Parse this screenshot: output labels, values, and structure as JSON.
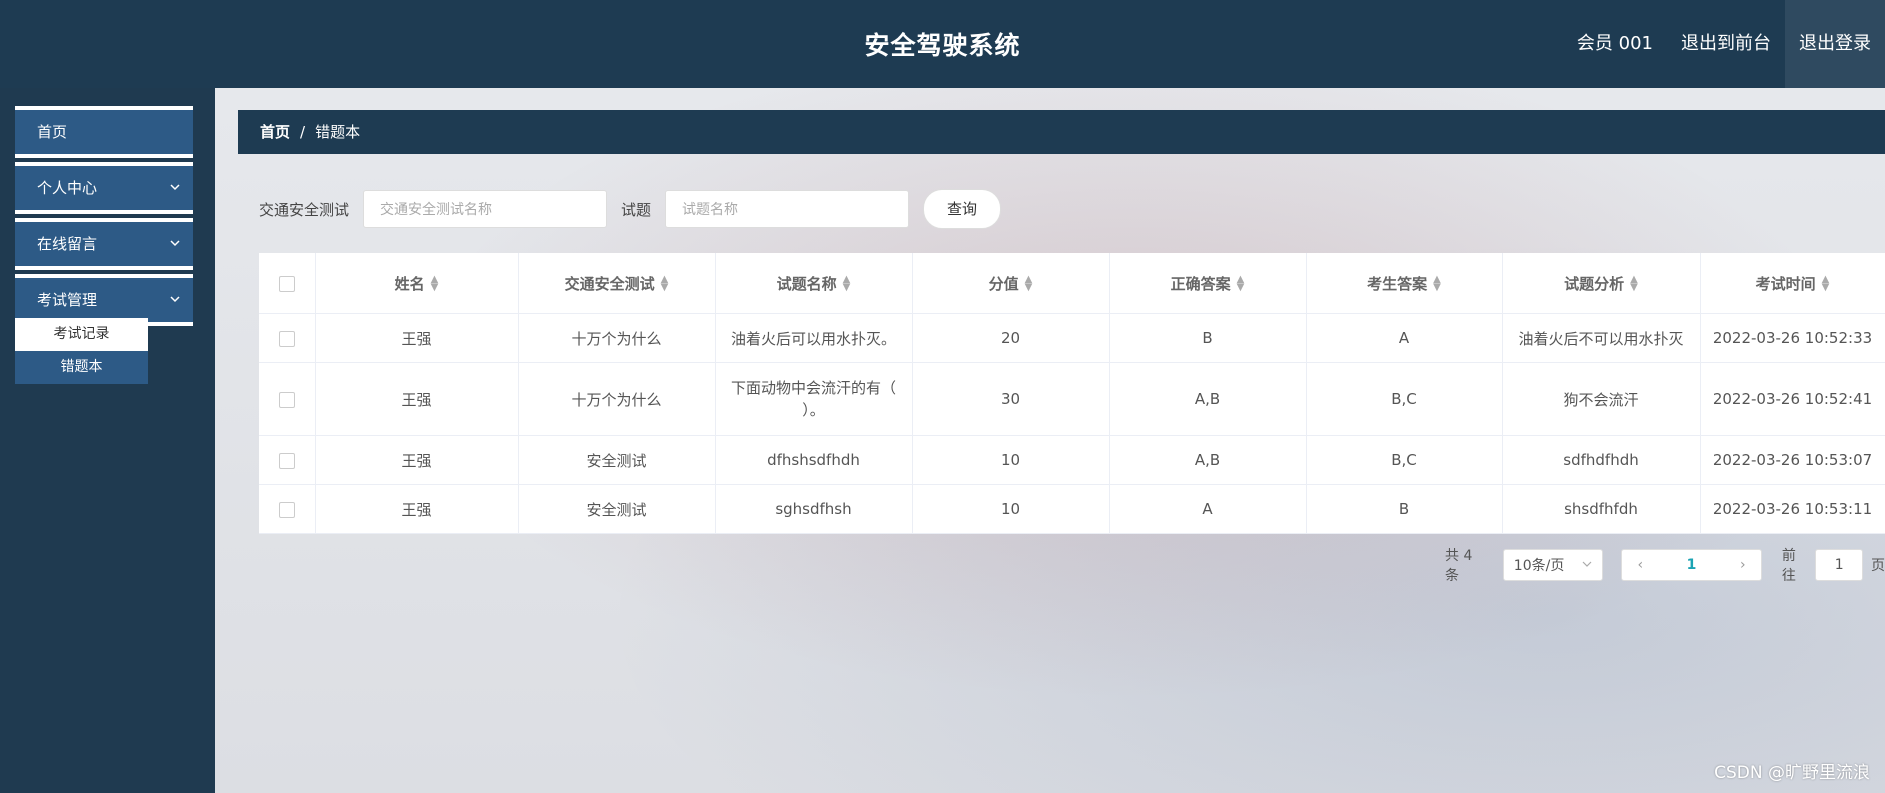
{
  "header": {
    "title": "安全驾驶系统",
    "user": "会员 001",
    "back_to_front": "退出到前台",
    "logout": "退出登录"
  },
  "sidebar": {
    "items": [
      {
        "label": "首页",
        "has_chevron": false
      },
      {
        "label": "个人中心",
        "has_chevron": true
      },
      {
        "label": "在线留言",
        "has_chevron": true
      },
      {
        "label": "考试管理",
        "has_chevron": true
      }
    ],
    "sub_items": [
      {
        "label": "考试记录",
        "active": false
      },
      {
        "label": "错题本",
        "active": true
      }
    ]
  },
  "breadcrumb": {
    "home": "首页",
    "separator": "/",
    "current": "错题本"
  },
  "search": {
    "test_label": "交通安全测试",
    "test_placeholder": "交通安全测试名称",
    "question_label": "试题",
    "question_placeholder": "试题名称",
    "button": "查询"
  },
  "table": {
    "columns": [
      "姓名",
      "交通安全测试",
      "试题名称",
      "分值",
      "正确答案",
      "考生答案",
      "试题分析",
      "考试时间"
    ],
    "rows": [
      [
        "王强",
        "十万个为什么",
        "油着火后可以用水扑灭。",
        "20",
        "B",
        "A",
        "油着火后不可以用水扑灭",
        "2022-03-26 10:52:33"
      ],
      [
        "王强",
        "十万个为什么",
        "下面动物中会流汗的有（ ）。",
        "30",
        "A,B",
        "B,C",
        "狗不会流汗",
        "2022-03-26 10:52:41"
      ],
      [
        "王强",
        "安全测试",
        "dfhshsdfhdh",
        "10",
        "A,B",
        "B,C",
        "sdfhdfhdh",
        "2022-03-26 10:53:07"
      ],
      [
        "王强",
        "安全测试",
        "sghsdfhsh",
        "10",
        "A",
        "B",
        "shsdfhfdh",
        "2022-03-26 10:53:11"
      ]
    ]
  },
  "pagination": {
    "total": "共 4 条",
    "page_size": "10条/页",
    "current_page": "1",
    "goto_label": "前往",
    "goto_value": "1",
    "page_suffix": "页"
  },
  "watermark": "CSDN @旷野里流浪",
  "colors": {
    "header_bg": "#1e3b52",
    "menu_active": "#2d5a86",
    "accent": "#1aa3b3"
  }
}
